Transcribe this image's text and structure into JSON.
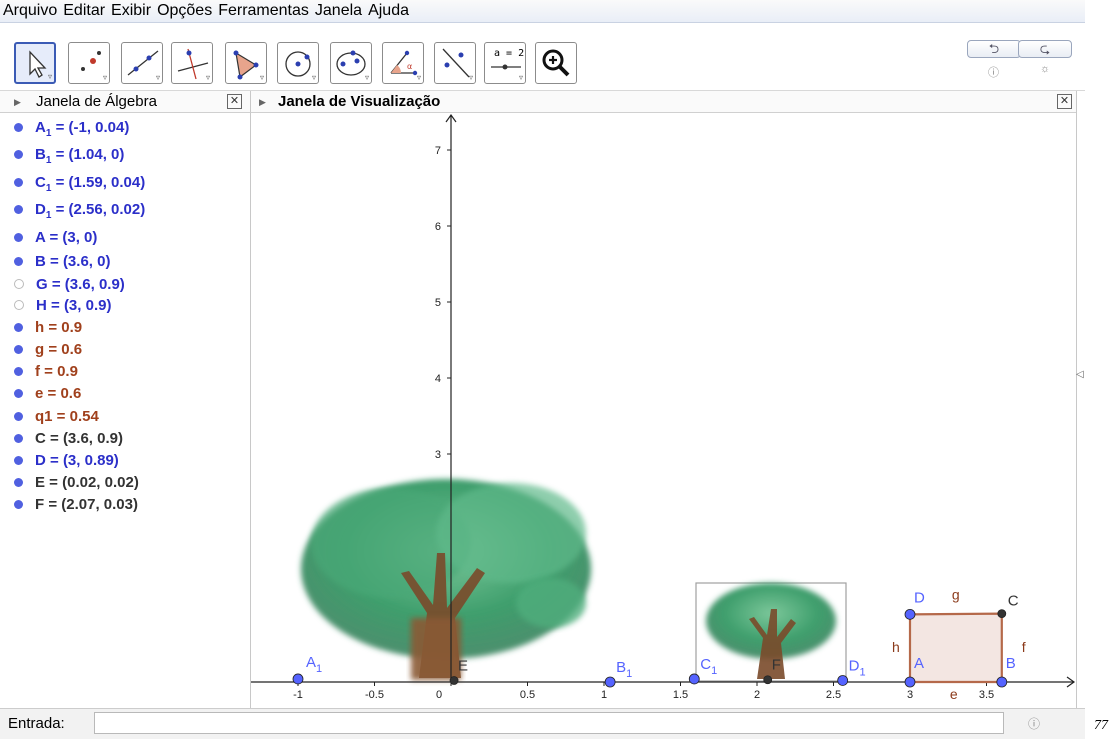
{
  "menu": [
    "Arquivo",
    "Editar",
    "Exibir",
    "Opções",
    "Ferramentas",
    "Janela",
    "Ajuda"
  ],
  "toolbar": {
    "tools": [
      {
        "name": "move-tool-button",
        "icon": "arrow-cursor-icon",
        "selected": true
      },
      {
        "name": "point-tool-button",
        "icon": "point-icon"
      },
      {
        "name": "line-tool-button",
        "icon": "line-through-two-points-icon"
      },
      {
        "name": "perpendicular-tool-button",
        "icon": "perpendicular-line-icon"
      },
      {
        "name": "polygon-tool-button",
        "icon": "polygon-icon"
      },
      {
        "name": "circle-tool-button",
        "icon": "circle-center-point-icon"
      },
      {
        "name": "conic-tool-button",
        "icon": "ellipse-icon"
      },
      {
        "name": "angle-tool-button",
        "icon": "angle-icon"
      },
      {
        "name": "reflect-tool-button",
        "icon": "reflect-about-line-icon"
      },
      {
        "name": "slider-tool-button",
        "icon": "slider-icon",
        "label": "a = 2"
      },
      {
        "name": "zoom-tool-button",
        "icon": "zoom-in-icon"
      }
    ],
    "undo_icon": "undo-icon",
    "redo_icon": "redo-icon",
    "help_icon": "help-icon",
    "settings_icon": "gear-icon"
  },
  "algebra": {
    "title": "Janela de Álgebra",
    "items": [
      {
        "name": "A",
        "sub": "1",
        "value": " = (-1, 0.04)",
        "color": "#2b2fc9",
        "dot": "#5060e0",
        "filled": true
      },
      {
        "name": "B",
        "sub": "1",
        "value": " = (1.04, 0)",
        "color": "#2b2fc9",
        "dot": "#5060e0",
        "filled": true
      },
      {
        "name": "C",
        "sub": "1",
        "value": " = (1.59, 0.04)",
        "color": "#2b2fc9",
        "dot": "#5060e0",
        "filled": true
      },
      {
        "name": "D",
        "sub": "1",
        "value": " = (2.56, 0.02)",
        "color": "#2b2fc9",
        "dot": "#5060e0",
        "filled": true
      },
      {
        "name": "A",
        "sub": "",
        "value": " = (3, 0)",
        "color": "#2b2fc9",
        "dot": "#5060e0",
        "filled": true
      },
      {
        "name": "B",
        "sub": "",
        "value": " = (3.6, 0)",
        "color": "#2b2fc9",
        "dot": "#5060e0",
        "filled": true
      },
      {
        "name": "G",
        "sub": "",
        "value": " = (3.6, 0.9)",
        "color": "#2b2fc9",
        "dot": "#bbbbbb",
        "filled": false
      },
      {
        "name": "H",
        "sub": "",
        "value": " = (3, 0.9)",
        "color": "#2b2fc9",
        "dot": "#bbbbbb",
        "filled": false
      },
      {
        "name": "h",
        "sub": "",
        "value": " = 0.9",
        "color": "#a0401c",
        "dot": "#5060e0",
        "filled": true
      },
      {
        "name": "g",
        "sub": "",
        "value": " = 0.6",
        "color": "#a0401c",
        "dot": "#5060e0",
        "filled": true
      },
      {
        "name": "f",
        "sub": "",
        "value": " = 0.9",
        "color": "#a0401c",
        "dot": "#5060e0",
        "filled": true
      },
      {
        "name": "e",
        "sub": "",
        "value": " = 0.6",
        "color": "#a0401c",
        "dot": "#5060e0",
        "filled": true
      },
      {
        "name": "q1",
        "sub": "",
        "value": " = 0.54",
        "color": "#a0401c",
        "dot": "#5060e0",
        "filled": true
      },
      {
        "name": "C",
        "sub": "",
        "value": " = (3.6, 0.9)",
        "color": "#333333",
        "dot": "#5060e0",
        "filled": true
      },
      {
        "name": "D",
        "sub": "",
        "value": " = (3, 0.89)",
        "color": "#2b2fc9",
        "dot": "#5060e0",
        "filled": true
      },
      {
        "name": "E",
        "sub": "",
        "value": " = (0.02, 0.02)",
        "color": "#333333",
        "dot": "#5060e0",
        "filled": true
      },
      {
        "name": "F",
        "sub": "",
        "value": " = (2.07, 0.03)",
        "color": "#333333",
        "dot": "#5060e0",
        "filled": true
      }
    ]
  },
  "graphics": {
    "title": "Janela de Visualização",
    "x_ticks": [
      "-1",
      "-0.5",
      "0",
      "0.5",
      "1",
      "1.5",
      "2",
      "2.5",
      "3",
      "3.5"
    ],
    "x_tick_values": [
      -1,
      -0.5,
      0,
      0.5,
      1,
      1.5,
      2,
      2.5,
      3,
      3.5
    ],
    "y_ticks": [
      "3",
      "4",
      "5",
      "6",
      "7"
    ],
    "y_tick_values": [
      3,
      4,
      5,
      6,
      7
    ],
    "x_range": [
      -1.27,
      4.2
    ],
    "y_range": [
      -0.04,
      7.5
    ],
    "points": [
      {
        "label": "A",
        "sub": "1",
        "x": -1,
        "y": 0.04,
        "color": "#5563ff",
        "label_color": "#5563ff"
      },
      {
        "label": "B",
        "sub": "1",
        "x": 1.04,
        "y": 0,
        "color": "#5563ff",
        "label_color": "#5563ff"
      },
      {
        "label": "C",
        "sub": "1",
        "x": 1.59,
        "y": 0.04,
        "color": "#5563ff",
        "label_color": "#5563ff"
      },
      {
        "label": "D",
        "sub": "1",
        "x": 2.56,
        "y": 0.02,
        "color": "#5563ff",
        "label_color": "#5563ff"
      },
      {
        "label": "A",
        "sub": "",
        "x": 3,
        "y": 0,
        "color": "#5563ff",
        "label_color": "#5563ff"
      },
      {
        "label": "B",
        "sub": "",
        "x": 3.6,
        "y": 0,
        "color": "#5563ff",
        "label_color": "#5563ff"
      },
      {
        "label": "C",
        "sub": "",
        "x": 3.6,
        "y": 0.9,
        "color": "#333333",
        "label_color": "#333333"
      },
      {
        "label": "D",
        "sub": "",
        "x": 3,
        "y": 0.89,
        "color": "#5563ff",
        "label_color": "#5563ff"
      },
      {
        "label": "E",
        "sub": "",
        "x": 0.02,
        "y": 0.02,
        "color": "#333333",
        "label_color": "#333333"
      },
      {
        "label": "F",
        "sub": "",
        "x": 2.07,
        "y": 0.03,
        "color": "#333333",
        "label_color": "#333333"
      }
    ],
    "segments": [
      {
        "label": "e",
        "value": 0.6
      },
      {
        "label": "f",
        "value": 0.9
      },
      {
        "label": "g",
        "value": 0.6
      },
      {
        "label": "h",
        "value": 0.9
      }
    ],
    "polygon_color": "#b5694a",
    "polygon_fill": "#f3e6e2"
  },
  "input": {
    "label": "Entrada:",
    "value": ""
  },
  "corner_text": "77"
}
